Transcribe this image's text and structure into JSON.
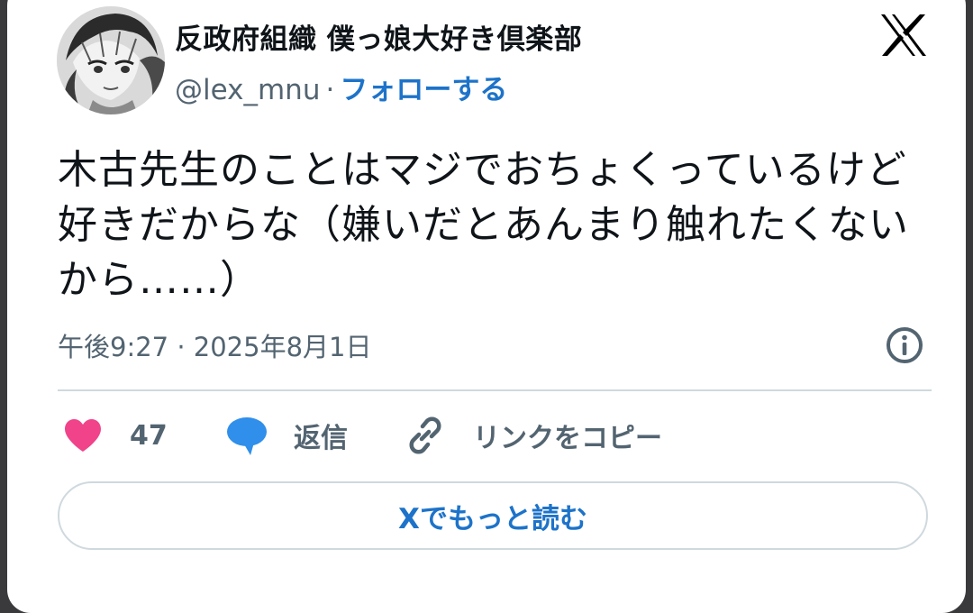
{
  "author": {
    "display_name": "反政府組織 僕っ娘大好き倶楽部",
    "handle": "@lex_mnu",
    "separator": "·",
    "follow_label": "フォローする"
  },
  "tweet": {
    "text": "木古先生のことはマジでおちょくっているけど好きだからな（嫌いだとあんまり触れたくないから……）",
    "time": "午後9:27",
    "separator": "·",
    "date": "2025年8月1日"
  },
  "actions": {
    "like_count": "47",
    "reply_label": "返信",
    "copy_link_label": "リンクをコピー"
  },
  "read_more_label": "Xでもっと読む",
  "icons": {
    "like": "heart-icon",
    "reply": "speech-bubble-icon",
    "copy": "link-icon",
    "info": "info-icon",
    "brand": "x-logo-icon"
  },
  "colors": {
    "heart": "#f0438a",
    "reply_bubble": "#2f8fea",
    "link_blue": "#1d73c9",
    "muted": "#536471"
  }
}
